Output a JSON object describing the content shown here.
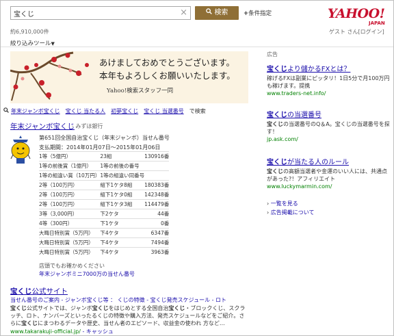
{
  "search": {
    "query": "宝くじ",
    "button_label": "検索",
    "conditions_label": "条件指定"
  },
  "header": {
    "logo_text": "YAHOO!",
    "logo_sub": "JAPAN",
    "result_count": "約6,910,000件",
    "user_label": "ゲスト さん",
    "login_label": "[ログイン]"
  },
  "refine_label": "絞り込みツール",
  "banner": {
    "line1": "あけましておめでとうございます。",
    "line2": "本年もよろしくお願いいたします。",
    "sign": "Yahoo!検索スタッフ一同"
  },
  "related": {
    "items": [
      "年末ジャンボ宝くじ",
      "宝くじ 当たる人",
      "初夢宝くじ",
      "宝くじ 当選番号"
    ],
    "suffix": "で検索"
  },
  "result1": {
    "title": "年末ジャンボ宝くじ",
    "source": "- みずほ銀行",
    "subtitle": "第651回全国自治宝くじ（年末ジャンボ）当せん番号",
    "period": "支払期間：2014年01月07日～2015年01月06日",
    "rows": [
      {
        "prize": "1等（5億円）",
        "group": "23組",
        "number": "130916番"
      },
      {
        "prize": "1等の前後賞（1億円）",
        "group": "1等の前後の番号",
        "number": ""
      },
      {
        "prize": "1等の組違い賞（10万円）",
        "group": "1等の組違い同番号",
        "number": ""
      },
      {
        "prize": "2等（100万円）",
        "group": "組下1ケタ8組",
        "number": "180383番"
      },
      {
        "prize": "2等（100万円）",
        "group": "組下1ケタ0組",
        "number": "142348番"
      },
      {
        "prize": "2等（100万円）",
        "group": "組下1ケタ3組",
        "number": "114479番"
      },
      {
        "prize": "3等（3,000円）",
        "group": "下2ケタ",
        "number": "44番"
      },
      {
        "prize": "4等（300円）",
        "group": "下1ケタ",
        "number": "0番"
      },
      {
        "prize": "大晦日特別賞（5万円）",
        "group": "下4ケタ",
        "number": "6347番"
      },
      {
        "prize": "大晦日特別賞（5万円）",
        "group": "下4ケタ",
        "number": "7494番"
      },
      {
        "prize": "大晦日特別賞（5万円）",
        "group": "下4ケタ",
        "number": "3963番"
      }
    ],
    "note": "店頭でもお確かめください",
    "link": "年末ジャンボミニ7000万の当せん番号"
  },
  "result2": {
    "title_bold": "宝くじ",
    "title_rest": "公式サイト",
    "crumbs": "当せん番号のご案内 - ジャンボ宝くじ等 ： くじの特徴 - 宝くじ発売スケジュール - ロト",
    "desc_parts": [
      {
        "b": true,
        "t": "宝くじ"
      },
      {
        "b": false,
        "t": "公式サイトでは、ジャンボ"
      },
      {
        "b": true,
        "t": "宝くじ"
      },
      {
        "b": false,
        "t": "をはじめとする全国自治"
      },
      {
        "b": true,
        "t": "宝くじ"
      },
      {
        "b": false,
        "t": "・ブロックくじ、スクラッチ、ロト、ナンバーズといったるくじの特徴や購入方法、発売スケジュールなどをご紹介。さらに"
      },
      {
        "b": true,
        "t": "宝くじ"
      },
      {
        "b": false,
        "t": "にまつわるデータや歴史、当せん者のエピソード、収益金の使われ 方など…"
      }
    ],
    "url": "www.takarakuji-official.jp/",
    "cache": "- キャッシュ"
  },
  "ads": {
    "label": "広告",
    "items": [
      {
        "title_b": "宝くじ",
        "title_r": "より儲かるFXとは？",
        "desc": "稼げるFXは副業にピッタリ！1日5分で月100万円も稼げます。提携",
        "url": "www.traders-net.info/"
      },
      {
        "title_b": "宝くじ",
        "title_r": "の当選番号",
        "desc_b": "宝くじ",
        "desc": "の当選番号のQ＆A。宝くじの当選番号を探す！",
        "url": "jp.ask.com/"
      },
      {
        "title_b": "宝くじ",
        "title_r": "が当たる人のルール",
        "desc_b": "宝くじ",
        "desc": "の高額当選者や金運のいい人には、共通点があった?！アフィリエイト",
        "url": "www.luckymarmin.com/"
      }
    ],
    "more_label": "一覧を見る",
    "about_label": "広告掲載について"
  },
  "colors": {
    "accent": "#8f6f36",
    "link": "#1a0dab",
    "url": "#008000",
    "logo": "#c8102e"
  }
}
